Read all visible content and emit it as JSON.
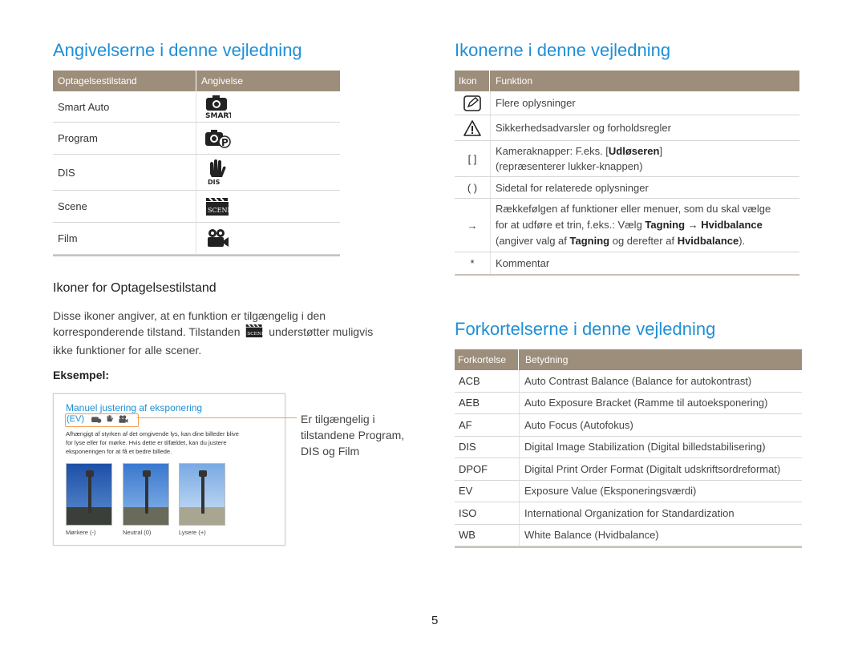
{
  "left": {
    "title": "Angivelserne i denne vejledning",
    "table": {
      "col1": "Optagelsestilstand",
      "col2": "Angivelse",
      "rows": [
        {
          "label": "Smart Auto",
          "icon": "smart-auto-icon"
        },
        {
          "label": "Program",
          "icon": "program-icon"
        },
        {
          "label": "DIS",
          "icon": "dis-icon"
        },
        {
          "label": "Scene",
          "icon": "scene-icon"
        },
        {
          "label": "Film",
          "icon": "film-icon"
        }
      ]
    },
    "subheading": "Ikoner for Optagelsestilstand",
    "para1": "Disse ikoner angiver, at en funktion er tilgængelig i den",
    "para2a": "korresponderende tilstand. Tilstanden",
    "para2b": "understøtter muligvis",
    "para3": "ikke funktioner for alle scener.",
    "example_label": "Eksempel:",
    "example": {
      "title": "Manuel justering af eksponering",
      "ev": "(EV)",
      "desc1": "Afhængigt af styrken af det omgivende lys, kan dine billeder blive",
      "desc2": "for lyse eller for mørke. Hvis dette er tilfældet, kan du justere",
      "desc3": "eksponeringen for at få et bedre billede.",
      "captions": [
        "Mørkere (-)",
        "Neutral (0)",
        "Lysere (+)"
      ],
      "callout1": "Er tilgængelig i",
      "callout2": "tilstandene Program,",
      "callout3": "DIS og Film"
    }
  },
  "right": {
    "title": "Ikonerne i denne vejledning",
    "table": {
      "col1": "Ikon",
      "col2": "Funktion",
      "rows": [
        {
          "icon": "note-icon",
          "text": "Flere oplysninger"
        },
        {
          "icon": "warning-icon",
          "text": "Sikkerhedsadvarsler og forholdsregler"
        },
        {
          "symbol": "[  ]",
          "line1_pre": "Kameraknapper: F.eks. [",
          "line1_kw": "Udløseren",
          "line1_post": "]",
          "line2": "(repræsenterer lukker-knappen)"
        },
        {
          "symbol": "(  )",
          "text": "Sidetal for relaterede oplysninger"
        },
        {
          "symbol": "→",
          "line1": "Rækkefølgen af funktioner eller menuer, som du skal vælge",
          "line2_pre": "for at udføre et trin, f.eks.: Vælg",
          "line2_kw1": "Tagning",
          "line2_arrow": "→",
          "line2_kw2": "Hvidbalance",
          "line3_pre": "(angiver valg af",
          "line3_kw1": "Tagning",
          "line3_mid": "og derefter af",
          "line3_kw2": "Hvidbalance",
          "line3_post": ")."
        },
        {
          "symbol": "*",
          "text": "Kommentar"
        }
      ]
    },
    "abbr_title": "Forkortelserne i denne vejledning",
    "abbr_table": {
      "col1": "Forkortelse",
      "col2": "Betydning",
      "rows": [
        {
          "abbr": "ACB",
          "meaning": "Auto Contrast Balance (Balance for autokontrast)"
        },
        {
          "abbr": "AEB",
          "meaning": "Auto Exposure Bracket (Ramme til autoeksponering)"
        },
        {
          "abbr": "AF",
          "meaning": "Auto Focus (Autofokus)"
        },
        {
          "abbr": "DIS",
          "meaning": "Digital Image Stabilization (Digital billedstabilisering)"
        },
        {
          "abbr": "DPOF",
          "meaning": "Digital Print Order Format (Digitalt udskriftsordreformat)"
        },
        {
          "abbr": "EV",
          "meaning": "Exposure Value (Eksponeringsværdi)"
        },
        {
          "abbr": "ISO",
          "meaning": "International Organization for Standardization"
        },
        {
          "abbr": "WB",
          "meaning": "White Balance (Hvidbalance)"
        }
      ]
    }
  },
  "page_number": "5",
  "colors": {
    "accent": "#1e8fd6",
    "header": "#9c8e7a",
    "callout": "#f0a050"
  }
}
